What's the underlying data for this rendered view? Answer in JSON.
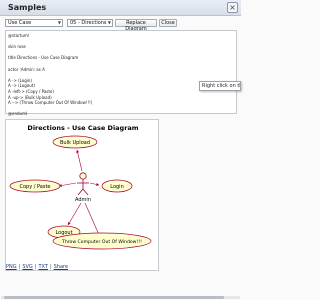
{
  "window": {
    "title": "Samples",
    "close_icon": "close-icon"
  },
  "toolbar": {
    "type_select": "Use Case",
    "sample_select": "05 - Directions",
    "replace_label": "Replace Diagram",
    "close_label": "Close"
  },
  "editor": {
    "code": "@startuml\n\nskin rose\n\ntitle Directions - Use Case Diagram\n\nactor :Admin: as A\n\nA -> (Login)\nA -> (Logout)\nA -left-> (Copy / Paste)\nA -up-> (Bulk Upload)\nA --> (Throw Computer Out Of Window!!!)\n\n@enduml"
  },
  "tooltip": {
    "text": "Right click on the"
  },
  "diagram": {
    "title": "Directions - Use Case Diagram",
    "actor": "Admin",
    "usecases": {
      "bulk_upload": "Bulk Upload",
      "copy_paste": "Copy / Paste",
      "login": "Login",
      "logout": "Logout",
      "throw": "Throw Computer Out Of Window!!!"
    },
    "colors": {
      "usecase_fill": "#FEFECE",
      "usecase_stroke": "#A80036",
      "arrow": "#A80036"
    }
  },
  "links": {
    "png": "PNG",
    "svg": "SVG",
    "txt": "TXT",
    "share": "Share"
  }
}
